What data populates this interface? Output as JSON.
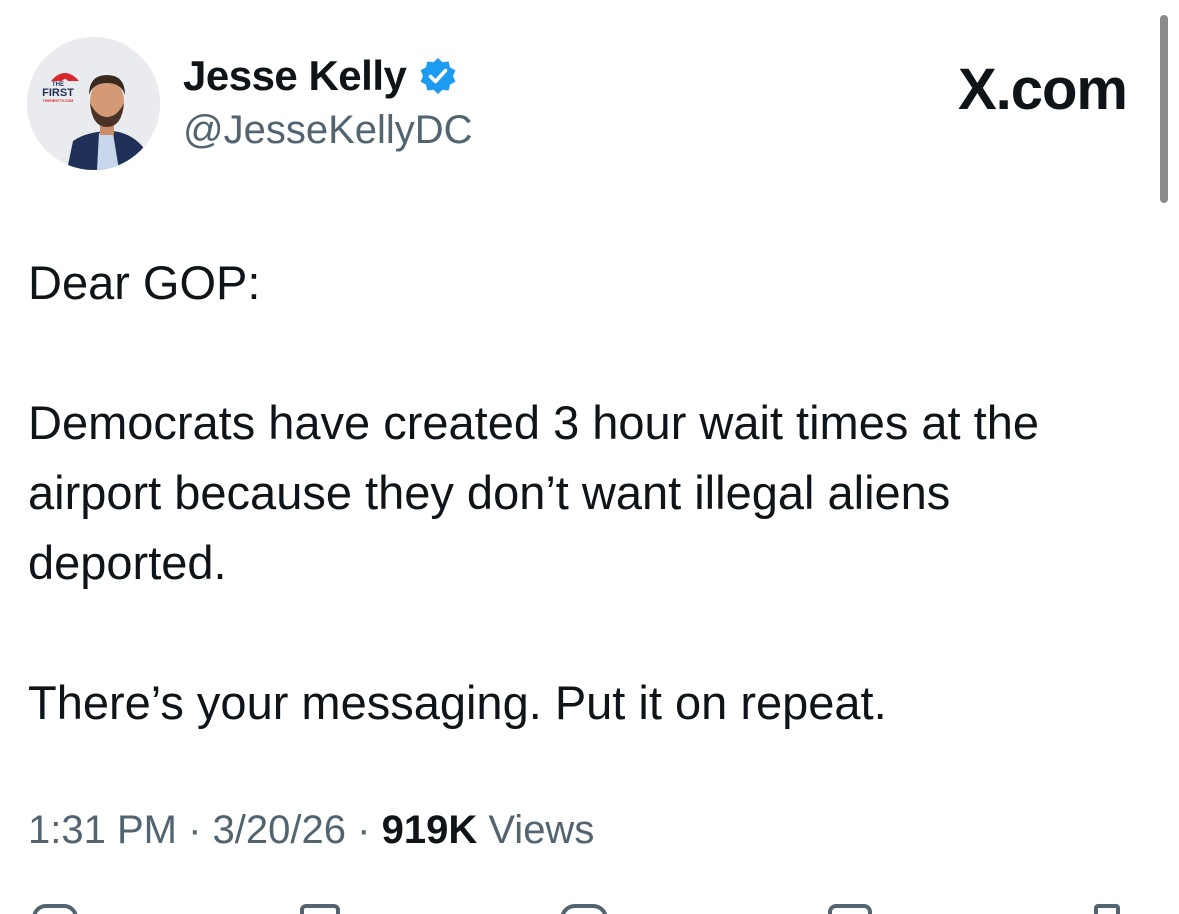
{
  "author": {
    "display_name": "Jesse Kelly",
    "handle": "@JesseKellyDC",
    "verified": true,
    "avatar_badge": {
      "line1": "THE",
      "line2": "FIRST",
      "line3": "THEFIRSTTV.COM"
    }
  },
  "brand": {
    "label": "X.com"
  },
  "tweet": {
    "paragraphs": [
      "Dear GOP:",
      "Democrats have created 3 hour wait times at the airport because they don’t want illegal aliens deported.",
      "There’s your messaging. Put it on repeat."
    ]
  },
  "meta": {
    "time": "1:31 PM",
    "separator": "·",
    "date": "3/20/26",
    "views_count": "919K",
    "views_label": "Views"
  },
  "colors": {
    "text_primary": "#0f1419",
    "text_secondary": "#536471",
    "verified_blue": "#1d9bf0",
    "badge_red": "#d8262c"
  },
  "icons": {
    "verified": "verified-badge-icon",
    "reply": "reply-icon",
    "repost": "repost-icon",
    "like": "heart-icon",
    "bookmark": "bookmark-icon",
    "share": "share-icon"
  }
}
